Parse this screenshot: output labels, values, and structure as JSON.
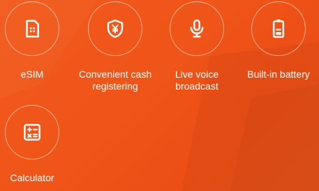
{
  "features": [
    {
      "label": "eSIM",
      "icon": "sim-card-icon"
    },
    {
      "label": "Convenient cash registering",
      "icon": "yuan-shield-icon"
    },
    {
      "label": "Live voice broadcast",
      "icon": "microphone-icon"
    },
    {
      "label": "Built-in battery",
      "icon": "battery-icon"
    },
    {
      "label": "Calculator",
      "icon": "calculator-icon"
    }
  ],
  "colors": {
    "background": "#ef5418",
    "icon": "#ffffff",
    "ring": "#ffffff"
  }
}
